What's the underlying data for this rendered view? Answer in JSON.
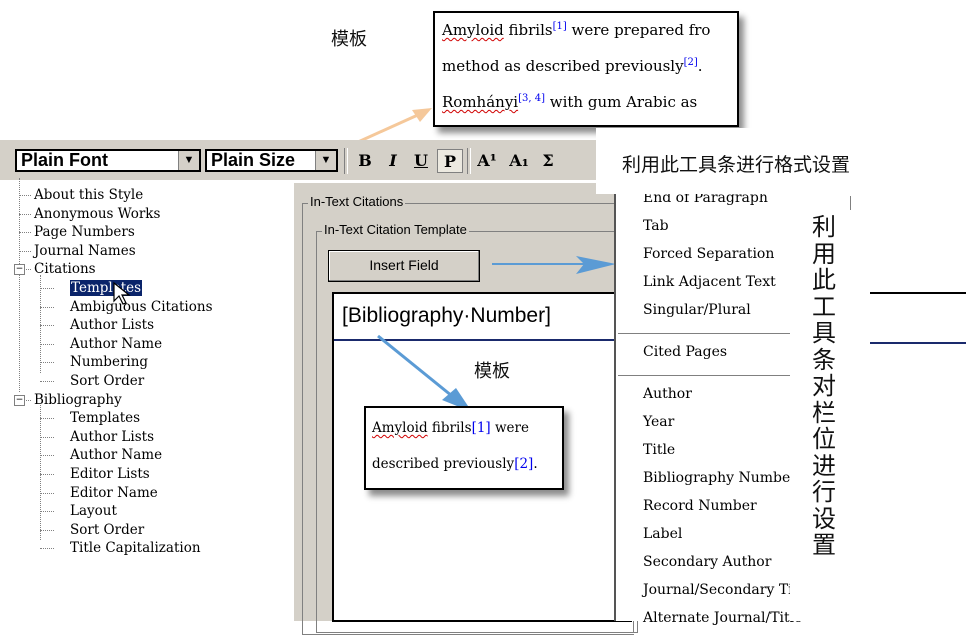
{
  "annotations": {
    "template_top": "模板",
    "template_mid": "模板",
    "toolbar_note": "利用此工具条进行格式设置",
    "field_note": "利用此工具条对栏位进行设置"
  },
  "sample_top": {
    "line1": {
      "word": "Amyloid",
      "pre": " fibrils",
      "cite": "[1]",
      "post": " were prepared fro"
    },
    "line2": {
      "text": "method as described previously",
      "cite": "[2]",
      "post": ". "
    },
    "line3": {
      "word": "Romhányi",
      "cite": "[3, 4]",
      "post": " with gum Arabic as"
    }
  },
  "sample_mid": {
    "line1": {
      "word": "Amyloid",
      "pre": " fibrils",
      "cite": "[1]",
      "post": " were"
    },
    "line2": {
      "text": "described previously",
      "cite": "[2]",
      "post": "."
    }
  },
  "toolbar": {
    "font": "Plain Font",
    "size": "Plain Size",
    "bold": "B",
    "italic": "I",
    "underline": "U",
    "plain": "P",
    "superscript": "A¹",
    "subscript": "A₁",
    "symbol": "Σ"
  },
  "tree": [
    {
      "label": "About this Style",
      "level": 0
    },
    {
      "label": "Anonymous Works",
      "level": 0
    },
    {
      "label": "Page Numbers",
      "level": 0
    },
    {
      "label": "Journal Names",
      "level": 0
    },
    {
      "label": "Citations",
      "level": 0,
      "expander": "−"
    },
    {
      "label": "Templates",
      "level": 1,
      "selected": true
    },
    {
      "label": "Ambiguous Citations",
      "level": 1
    },
    {
      "label": "Author Lists",
      "level": 1
    },
    {
      "label": "Author Name",
      "level": 1
    },
    {
      "label": "Numbering",
      "level": 1
    },
    {
      "label": "Sort Order",
      "level": 1
    },
    {
      "label": "Bibliography",
      "level": 0,
      "expander": "−"
    },
    {
      "label": "Templates",
      "level": 1
    },
    {
      "label": "Author Lists",
      "level": 1
    },
    {
      "label": "Author Name",
      "level": 1
    },
    {
      "label": "Editor Lists",
      "level": 1
    },
    {
      "label": "Editor Name",
      "level": 1
    },
    {
      "label": "Layout",
      "level": 1
    },
    {
      "label": "Sort Order",
      "level": 1
    },
    {
      "label": "Title Capitalization",
      "level": 1
    }
  ],
  "panel": {
    "group_outer": "In-Text Citations",
    "group_inner": "In-Text Citation Template",
    "insert_button": "Insert Field",
    "template_field": "[Bibliography·Number]"
  },
  "menu": {
    "items": [
      {
        "label": "End of Paragraph"
      },
      {
        "label": "Tab"
      },
      {
        "label": "Forced Separation"
      },
      {
        "label": "Link Adjacent Text"
      },
      {
        "label": "Singular/Plural"
      },
      {
        "label": "Cited Pages",
        "sep_before": true
      },
      {
        "label": "Author",
        "sep_before": true
      },
      {
        "label": "Year"
      },
      {
        "label": "Title"
      },
      {
        "label": "Bibliography Number"
      },
      {
        "label": "Record Number"
      },
      {
        "label": "Label"
      },
      {
        "label": "Secondary Author"
      },
      {
        "label": "Journal/Secondary Title"
      },
      {
        "label": "Alternate Journal/Title"
      }
    ]
  },
  "colors": {
    "arrow_orange": "#f5c89a",
    "arrow_blue": "#5b9bd5",
    "selection": "#0a246a",
    "link": "#0000ee"
  }
}
